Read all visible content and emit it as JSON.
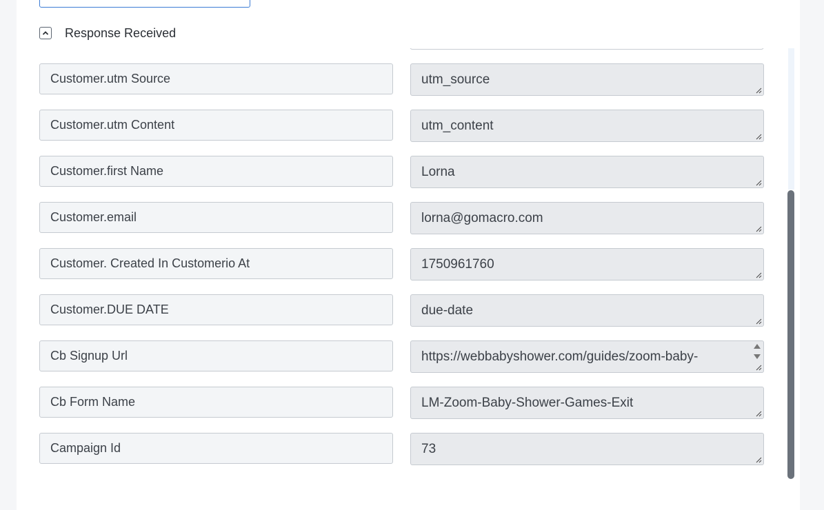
{
  "section": {
    "title": "Response Received",
    "toggle_icon": "chevron-up-icon"
  },
  "fields": [
    {
      "label": "Customer.utm Source",
      "value": "utm_source"
    },
    {
      "label": "Customer.utm Content",
      "value": "utm_content"
    },
    {
      "label": "Customer.first Name",
      "value": "Lorna"
    },
    {
      "label": "Customer.email",
      "value": "lorna@gomacro.com"
    },
    {
      "label": "Customer. Created In Customerio At",
      "value": "1750961760"
    },
    {
      "label": "Customer.DUE DATE",
      "value": "due-date"
    },
    {
      "label": "Cb Signup Url",
      "value": "https://webbabyshower.com/guides/zoom-baby-"
    },
    {
      "label": "Cb Form Name",
      "value": "LM-Zoom-Baby-Shower-Games-Exit"
    },
    {
      "label": "Campaign Id",
      "value": "73"
    }
  ],
  "colors": {
    "accent_border": "#3b7bd4",
    "scrollbar_thumb": "#6b727b"
  }
}
